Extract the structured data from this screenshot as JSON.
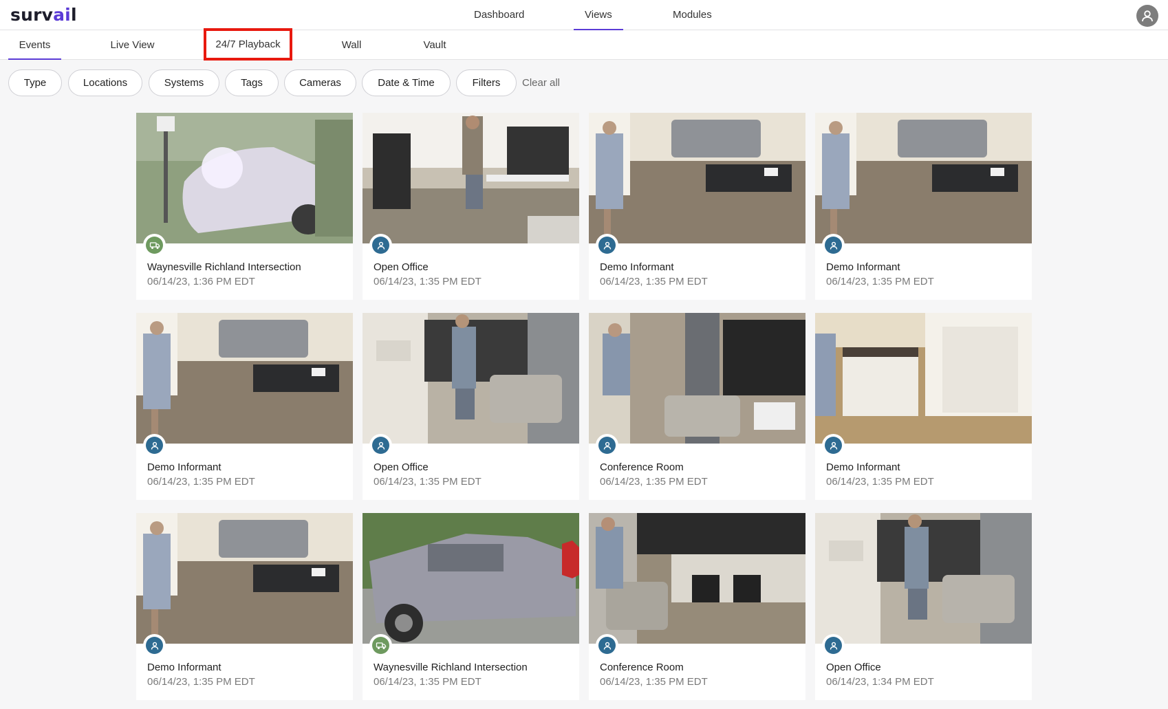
{
  "app": {
    "logo_prefix": "surv",
    "logo_accent": "ai",
    "logo_suffix": "l",
    "accent_color": "#5b3bd6",
    "highlight_color": "#e8190f"
  },
  "main_nav": {
    "items": [
      {
        "label": "Dashboard",
        "active": false
      },
      {
        "label": "Views",
        "active": true
      },
      {
        "label": "Modules",
        "active": false
      }
    ],
    "avatar_icon": "user-avatar-icon"
  },
  "sub_nav": {
    "tabs": [
      {
        "label": "Events",
        "active": true
      },
      {
        "label": "Live View",
        "active": false
      },
      {
        "label": "24/7 Playback",
        "active": false,
        "highlighted": true
      },
      {
        "label": "Wall",
        "active": false
      },
      {
        "label": "Vault",
        "active": false
      }
    ]
  },
  "filters": {
    "chips": [
      "Type",
      "Locations",
      "Systems",
      "Tags",
      "Cameras",
      "Date & Time",
      "Filters"
    ],
    "clear_all": "Clear all"
  },
  "events": [
    {
      "title": "Waynesville Richland Intersection",
      "time": "06/14/23, 1:36 PM EDT",
      "type": "vehicle",
      "scene": "car"
    },
    {
      "title": "Open Office",
      "time": "06/14/23, 1:35 PM EDT",
      "type": "person",
      "scene": "office"
    },
    {
      "title": "Demo Informant",
      "time": "06/14/23, 1:35 PM EDT",
      "type": "person",
      "scene": "lounge"
    },
    {
      "title": "Demo Informant",
      "time": "06/14/23, 1:35 PM EDT",
      "type": "person",
      "scene": "lounge"
    },
    {
      "title": "Demo Informant",
      "time": "06/14/23, 1:35 PM EDT",
      "type": "person",
      "scene": "lounge"
    },
    {
      "title": "Open Office",
      "time": "06/14/23, 1:35 PM EDT",
      "type": "person",
      "scene": "hall"
    },
    {
      "title": "Conference Room",
      "time": "06/14/23, 1:35 PM EDT",
      "type": "person",
      "scene": "conference"
    },
    {
      "title": "Demo Informant",
      "time": "06/14/23, 1:35 PM EDT",
      "type": "person",
      "scene": "kitchen"
    },
    {
      "title": "Demo Informant",
      "time": "06/14/23, 1:35 PM EDT",
      "type": "person",
      "scene": "lounge"
    },
    {
      "title": "Waynesville Richland Intersection",
      "time": "06/14/23, 1:35 PM EDT",
      "type": "vehicle",
      "scene": "truck"
    },
    {
      "title": "Conference Room",
      "time": "06/14/23, 1:35 PM EDT",
      "type": "person",
      "scene": "conference2"
    },
    {
      "title": "Open Office",
      "time": "06/14/23, 1:34 PM EDT",
      "type": "person",
      "scene": "hall"
    }
  ]
}
